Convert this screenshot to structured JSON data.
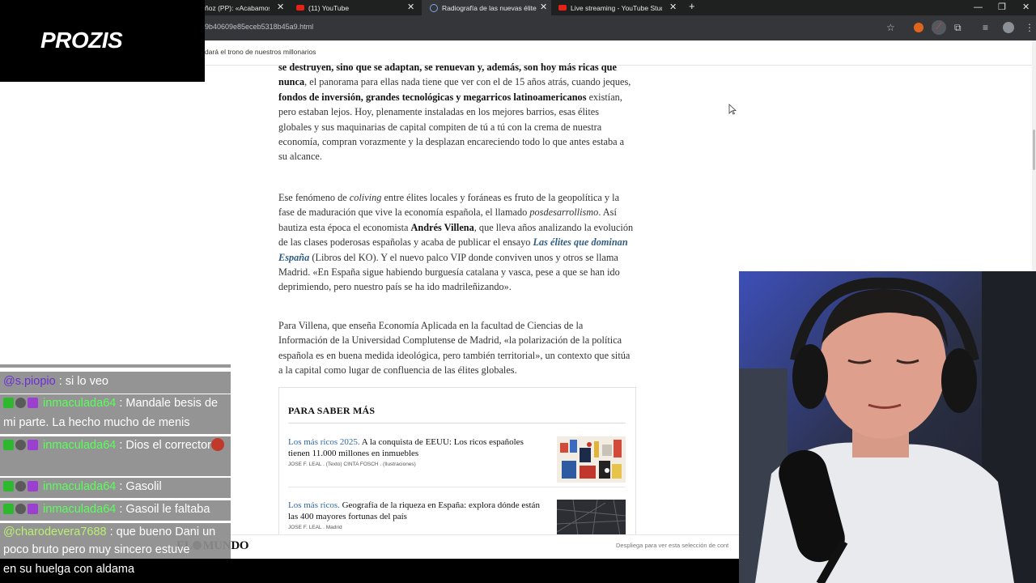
{
  "browser": {
    "tabs": [
      {
        "label": "ñoz (PP): «Acabamos d",
        "icon": "globe-icon"
      },
      {
        "label": "(11) YouTube",
        "icon": "youtube-icon"
      },
      {
        "label": "Radiografía de las nuevas élite",
        "icon": "globe-icon",
        "active": true
      },
      {
        "label": "Live streaming - YouTube Studi",
        "icon": "youtube-icon"
      }
    ],
    "new_tab_glyph": "+",
    "close_glyph": "✕",
    "url": "9b40609e85eceb5318b45a9.html",
    "window_controls": [
      "—",
      "❐",
      "✕"
    ],
    "toolbar_icons": [
      "star-icon",
      "extension-orange-icon",
      "extension-red-icon",
      "puzzle-icon",
      "media-icon",
      "profile-icon",
      "menu-icon"
    ]
  },
  "page": {
    "bookmark_text": "dará el trono de nuestros millonarios",
    "para1": {
      "b1": "se destruyen, sino que se adaptan, se renuevan y, además, son hoy más ricas que nunca",
      "t1": ", el panorama para ellas nada tiene que ver con el de 15 años atrás, cuando jeques, ",
      "b2": "fondos de inversión, grandes tecnológicas y megarricos latinoamericanos",
      "t2": " existían, pero estaban lejos. Hoy, plenamente instaladas en los mejores barrios, esas élites globales y sus maquinarias de capital compiten de tú a tú con la crema de nuestra economía, compran vorazmente y la desplazan encareciendo todo lo que antes estaba a su alcance."
    },
    "para2": {
      "t1": "Ese fenómeno de ",
      "i1": "coliving",
      "t2": " entre élites locales y foráneas es fruto de la geopolítica y la fase de maduración que vive la economía española, el llamado ",
      "i2": "posdesarrollismo",
      "t3": ". Así bautiza esta época el economista ",
      "b1": "Andrés Villena",
      "t4": ", que lleva años analizando la evolución de las clases poderosas españolas y acaba de publicar el ensayo ",
      "link": "Las élites que dominan España",
      "t5": " (Libros del KO). Y el nuevo palco VIP donde conviven unos y otros se llama Madrid. «En España sigue habiendo burguesía catalana y vasca, pese a que se han ido deprimiendo, pero nuestro país se ha ido madrileñizando»."
    },
    "para3": "Para Villena, que enseña Economía Aplicada en la facultad de Ciencias de la Información de la Universidad Complutense de Madrid, «la polarización de la política española es en buena medida ideológica, pero también territorial», un contexto que sitúa a la capital como lugar de confluencia de las élites globales.",
    "saber_mas": {
      "title": "PARA SABER MÁS",
      "items": [
        {
          "kicker": "Los más ricos 2025.",
          "headline": " A la conquista de EEUU: Los ricos españoles tienen 11.000 millones en inmuebles",
          "byline": "JOSE F. LEAL . (Texto)   CINTA FOSCH . (Ilustraciones)"
        },
        {
          "kicker": "Los más ricos.",
          "headline": " Geografía de la riqueza en España: explora dónde están las 400 mayores fortunas del país",
          "byline": "JOSE F. LEAL . Madrid"
        }
      ]
    },
    "footer": {
      "logo_left": "EL",
      "logo_right": "MUNDO",
      "hint": "Despliega para ver esta selección de cont"
    }
  },
  "overlay": {
    "brand": "PROZIS",
    "chat": [
      {
        "user": "@s.piopio",
        "user_color": "#6a2fd6",
        "badges": [],
        "message": " : si lo veo"
      },
      {
        "user": "inmaculada64",
        "user_color": "#58ff58",
        "badges": [
          "green",
          "grey",
          "purple"
        ],
        "message": " : Mandale besis de mi parte. La hecho mucho de menis"
      },
      {
        "user": "inmaculada64",
        "user_color": "#58ff58",
        "badges": [
          "green",
          "grey",
          "purple"
        ],
        "message": " : Dios el corrector"
      },
      {
        "user": "inmaculada64",
        "user_color": "#58ff58",
        "badges": [
          "green",
          "grey",
          "purple"
        ],
        "message": " : Gasolil"
      },
      {
        "user": "inmaculada64",
        "user_color": "#58ff58",
        "badges": [
          "green",
          "grey",
          "purple"
        ],
        "message": " : Gasoil le faltaba"
      },
      {
        "user": "@charodevera7688",
        "user_color": "#b9f06e",
        "badges": [],
        "message": " : que bueno Dani un poco bruto pero muy sincero estuve"
      }
    ],
    "caption": "en su huelga con aldama"
  }
}
